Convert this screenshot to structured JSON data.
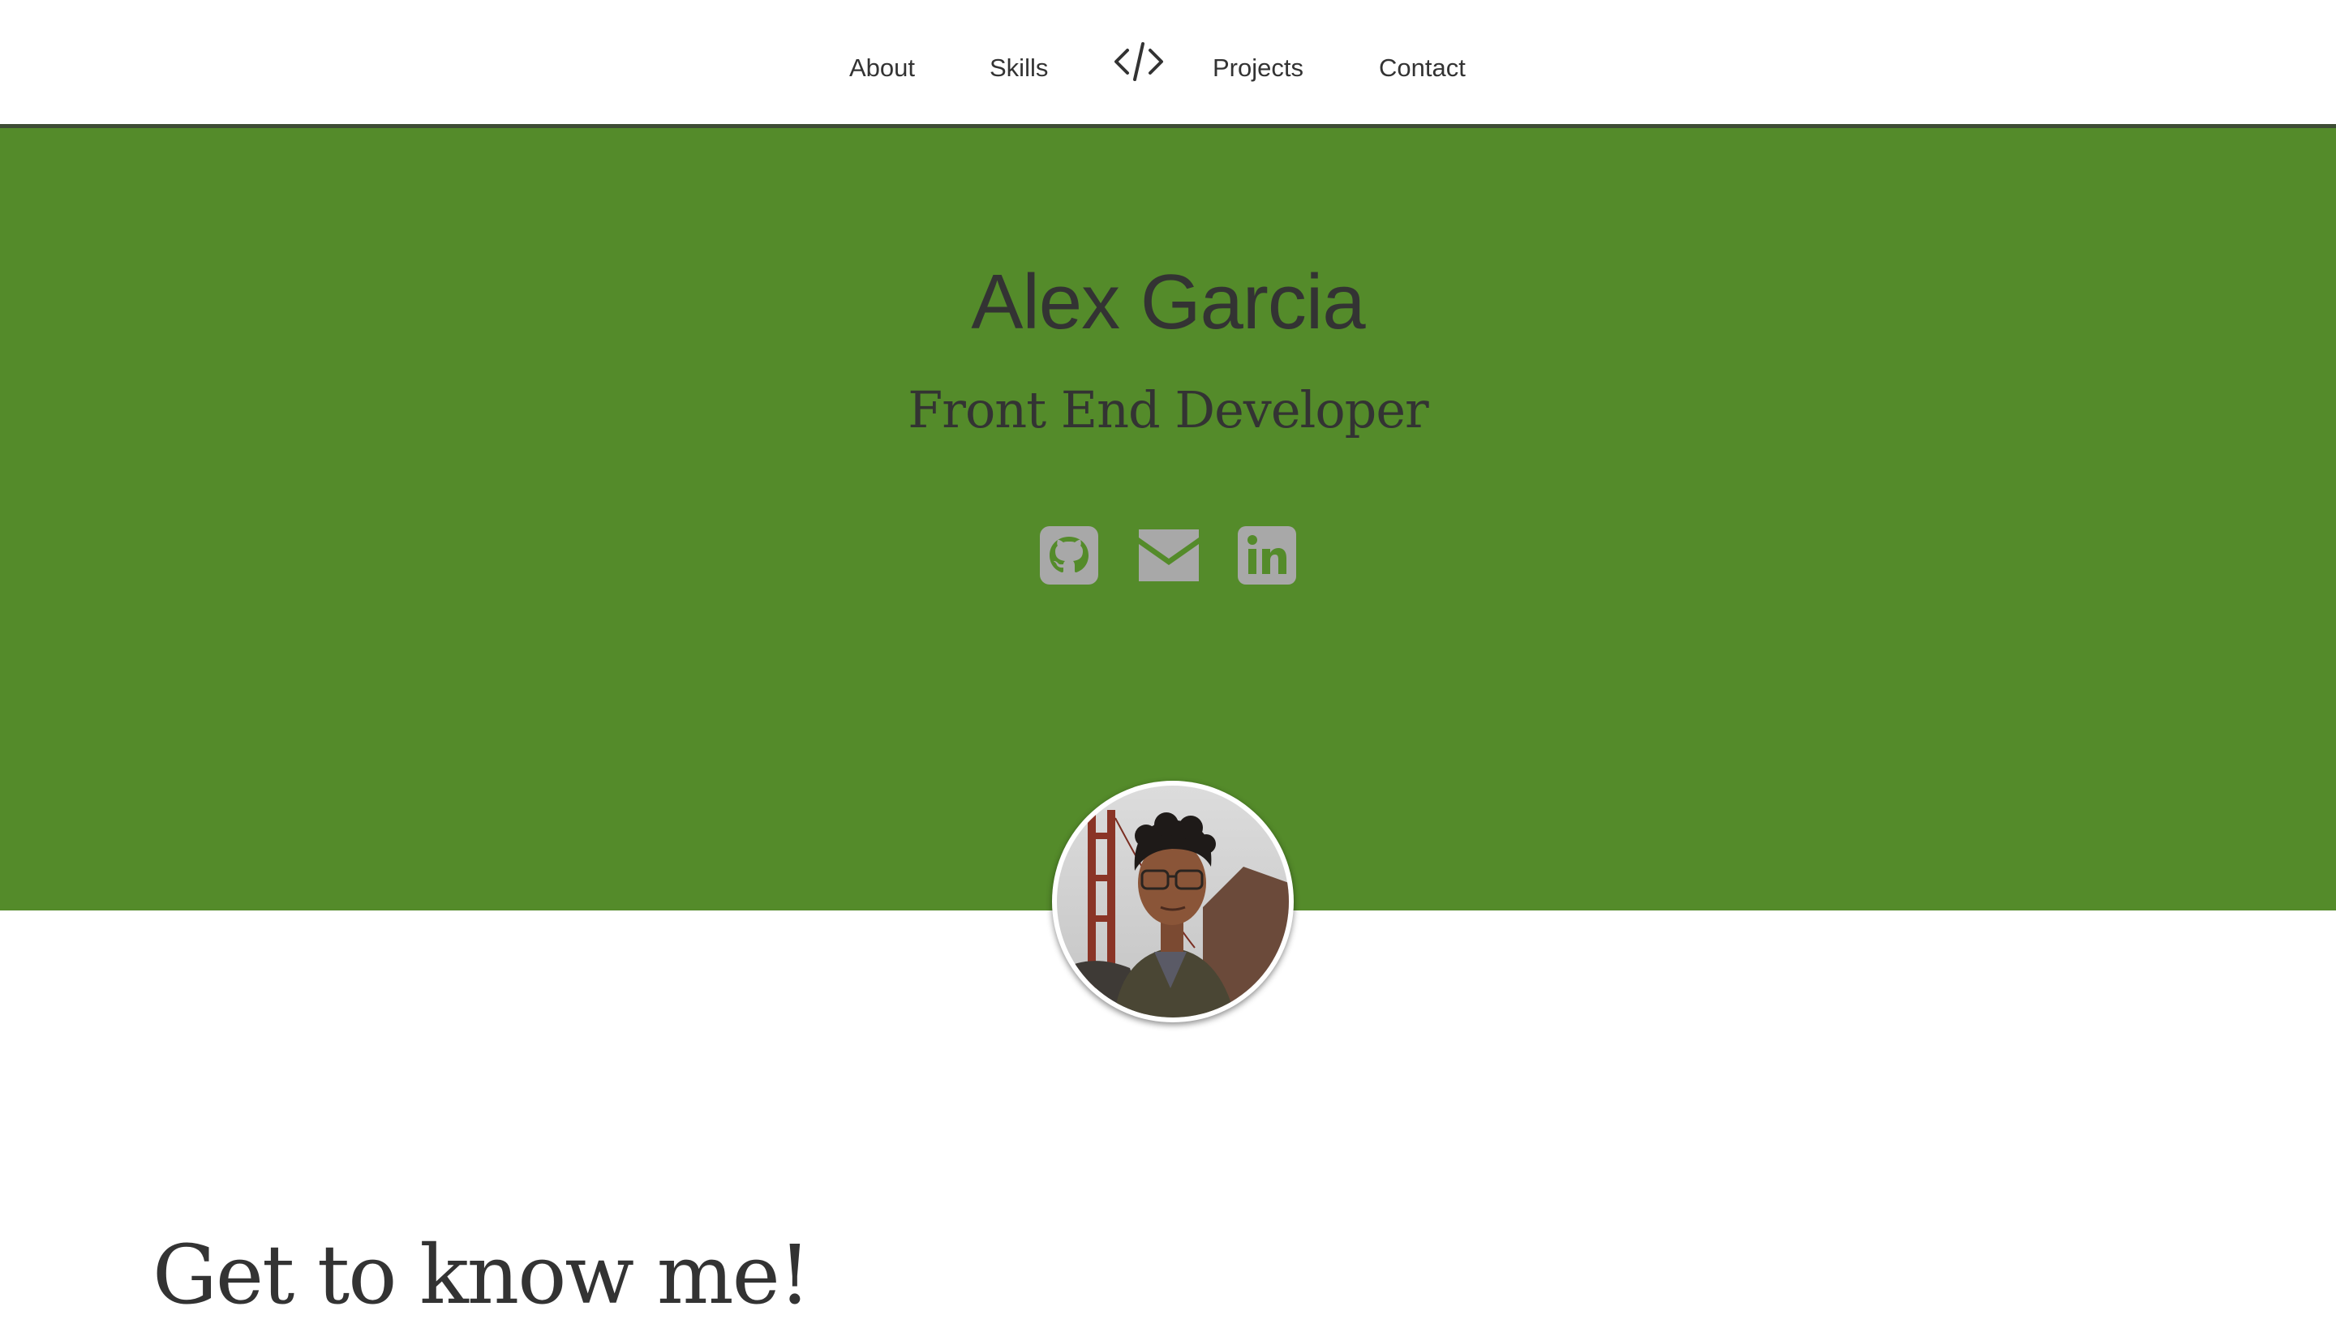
{
  "nav": {
    "items": [
      {
        "label": "About"
      },
      {
        "label": "Skills"
      },
      {
        "label": "Projects"
      },
      {
        "label": "Contact"
      }
    ],
    "logo_icon": "code-brackets-icon"
  },
  "hero": {
    "name": "Alex Garcia",
    "title": "Front End Developer",
    "background_color": "#548b2a",
    "social_icons": [
      "github-icon",
      "email-icon",
      "linkedin-icon"
    ]
  },
  "about": {
    "heading": "Get to know me!"
  }
}
